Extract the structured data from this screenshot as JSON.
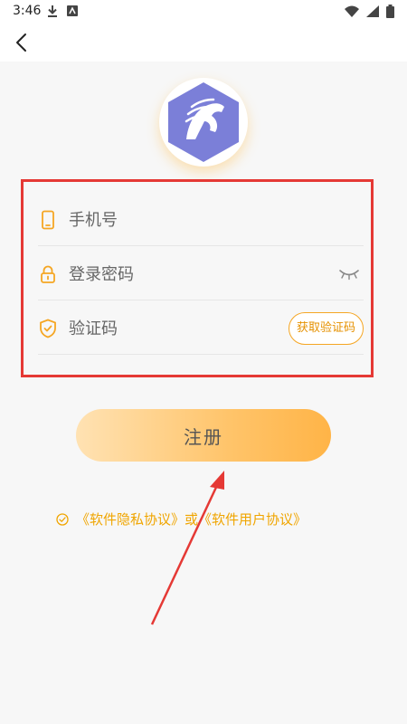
{
  "status": {
    "time": "3:46",
    "left_icons": [
      "download-icon",
      "text-badge-icon"
    ],
    "right_icons": [
      "wifi-icon",
      "signal-icon",
      "battery-icon"
    ]
  },
  "nav": {
    "back_icon": "chevron-left-icon"
  },
  "logo": {
    "icon": "horse-head-hexagon-logo"
  },
  "form": {
    "phone_placeholder": "手机号",
    "password_placeholder": "登录密码",
    "code_placeholder": "验证码",
    "get_code_label": "获取验证码",
    "icons": {
      "phone": "phone-icon",
      "password": "lock-icon",
      "code": "shield-check-icon",
      "toggle": "eye-closed-icon"
    }
  },
  "actions": {
    "register_label": "注册"
  },
  "agreement": {
    "privacy_link": "《软件隐私协议》",
    "or_text": "或",
    "user_link": "《软件用户协议》"
  },
  "colors": {
    "accent": "#f5a623",
    "highlight_border": "#e53935",
    "button_gradient_start": "#ffe2b3",
    "button_gradient_end": "#ffb447",
    "logo_purple": "#7b7fd8"
  }
}
